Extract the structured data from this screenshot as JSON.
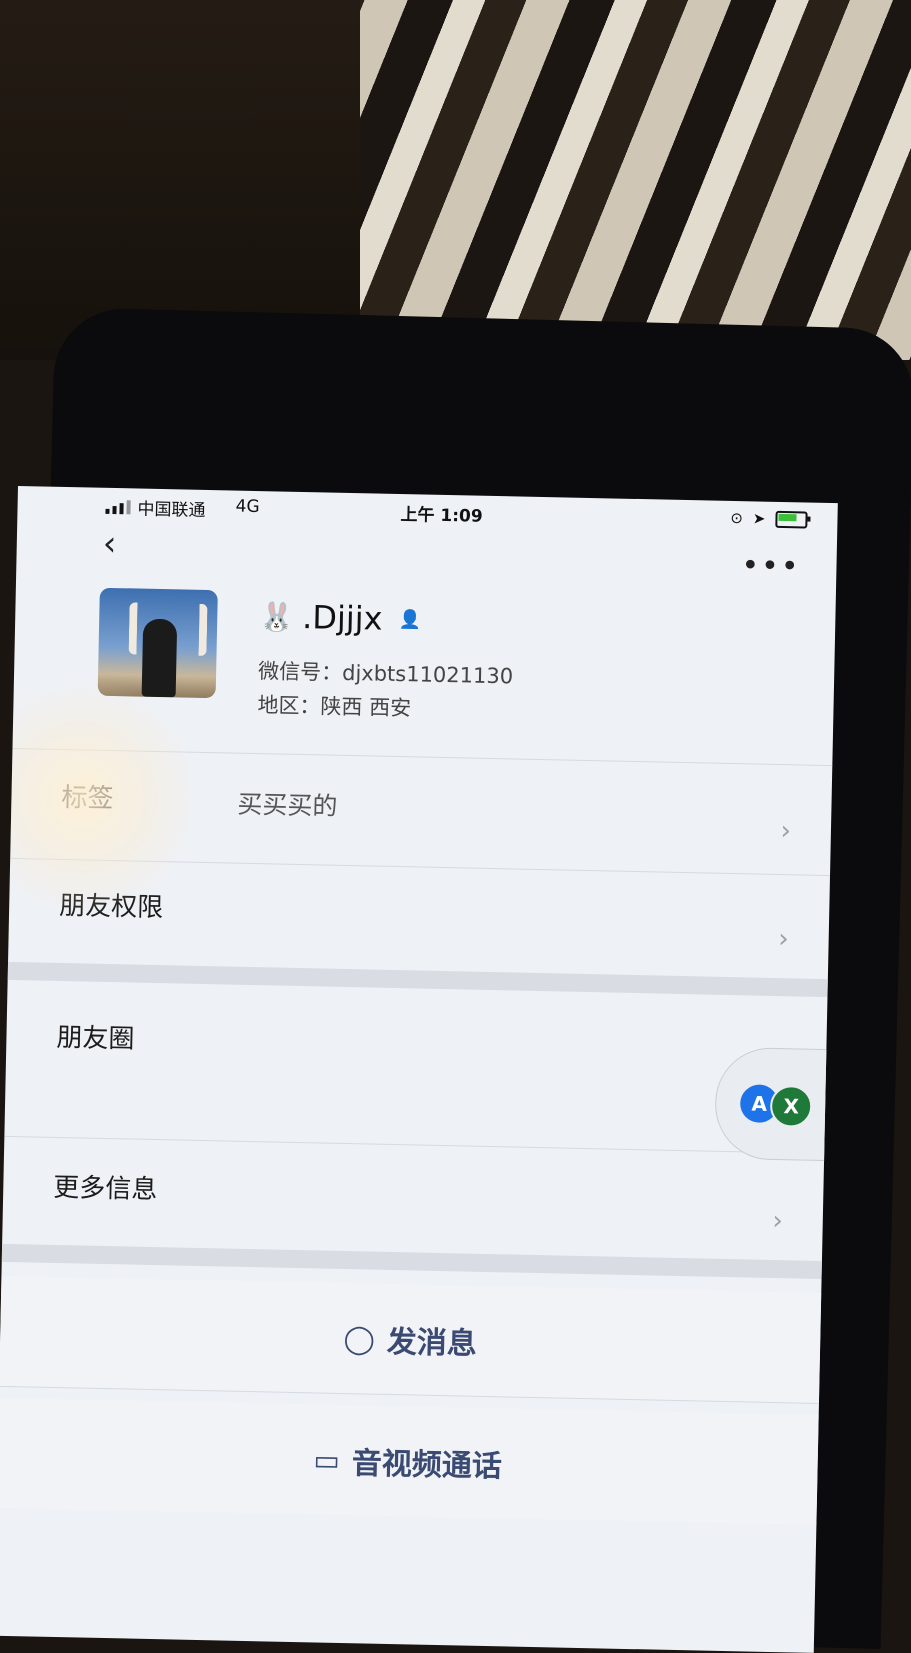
{
  "status_bar": {
    "carrier": "中国联通",
    "network": "4G",
    "time": "上午 1:09"
  },
  "nav": {
    "back_icon": "chevron-left-icon",
    "more_label": "•••"
  },
  "profile": {
    "emoji": "🐰",
    "nickname": ".Djjjx",
    "wechat_id": "微信号：djxbts11021130",
    "region": "地区：陕西 西安"
  },
  "rows": {
    "tags_label": "标签",
    "tags_value": "买买买的",
    "permissions_label": "朋友权限",
    "moments_label": "朋友圈",
    "more_info_label": "更多信息",
    "chevron": "›"
  },
  "floating_apps": {
    "a_label": "A",
    "x_label": "X"
  },
  "actions": {
    "message_label": "发消息",
    "call_label": "音视频通话"
  }
}
